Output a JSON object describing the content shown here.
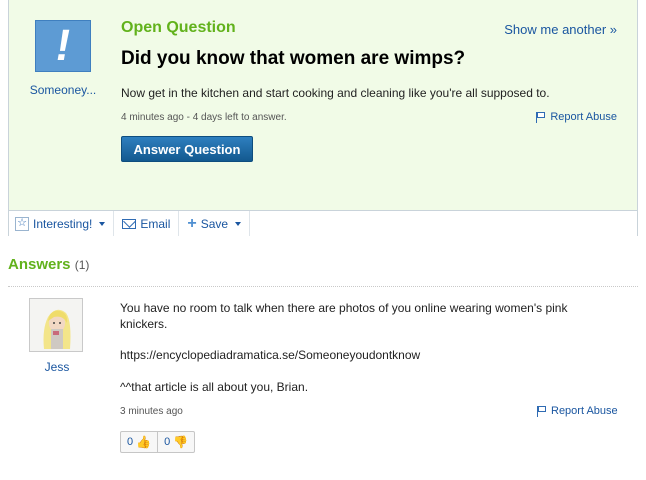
{
  "question": {
    "kind": "Open Question",
    "show_another": "Show me another »",
    "asker": "Someoney...",
    "avatar_glyph": "!",
    "title": "Did you know that women are wimps?",
    "body": "Now get in the kitchen and start cooking and cleaning like you're all supposed to.",
    "meta": "4 minutes ago - 4 days left to answer.",
    "report_label": "Report Abuse",
    "answer_button": "Answer Question"
  },
  "toolbar": {
    "interesting": "Interesting!",
    "email": "Email",
    "save": "Save"
  },
  "answers": {
    "heading": "Answers",
    "count": "(1)",
    "items": [
      {
        "user": "Jess",
        "line1": "You have no room to talk when there are photos of you online wearing women's pink",
        "line2": "knickers.",
        "link": "https://encyclopediadramatica.se/Someoneyoudontknow",
        "line3": "^^that article is all about you, Brian.",
        "meta": "3 minutes ago",
        "report_label": "Report Abuse",
        "thumbs_up": "0",
        "thumbs_down": "0"
      }
    ]
  },
  "colors": {
    "accent_green": "#62b21c",
    "link_blue": "#1a56a0",
    "question_bg": "#f1fbe7",
    "button_blue": "#13598f"
  }
}
